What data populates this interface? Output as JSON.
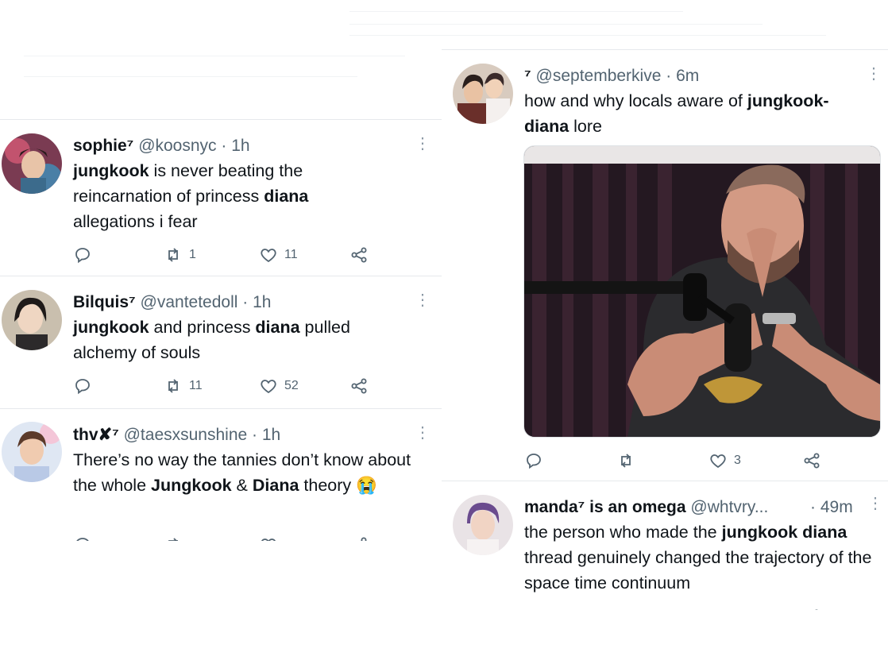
{
  "left_column": {
    "tweets": [
      {
        "name": "sophie⁷",
        "handle": "@koosnyc",
        "time": "1h",
        "text_parts": [
          "jungkook",
          " is never beating the reincarnation of princess ",
          "diana",
          " allegations i fear"
        ],
        "replies": "",
        "retweets": "1",
        "likes": "11"
      },
      {
        "name": "Bilquis⁷",
        "handle": "@vantetedoll",
        "time": "1h",
        "text_parts": [
          "jungkook",
          " and princess ",
          "diana",
          " pulled alchemy of souls"
        ],
        "replies": "",
        "retweets": "11",
        "likes": "52"
      },
      {
        "name": "thv✘⁷",
        "handle": "@taesxsunshine",
        "time": "1h",
        "text_parts": [
          "There’s no way the tannies don’t know about the whole ",
          "Jungkook",
          " & ",
          "Diana",
          " theory ",
          "😭"
        ],
        "replies": "",
        "retweets": "",
        "likes": ""
      }
    ]
  },
  "right_column": {
    "tweets": [
      {
        "name": "⁷",
        "handle": "@septemberkive",
        "time": "6m",
        "text_parts": [
          "how and why locals aware of ",
          "jungkook-diana",
          " lore"
        ],
        "replies": "",
        "retweets": "",
        "likes": "3",
        "has_media": true
      },
      {
        "name": "manda⁷ is an omega",
        "handle": "@whtvry...",
        "time": "49m",
        "text_parts": [
          "the person who made the ",
          "jungkook",
          " ",
          "diana",
          " thread genuinely changed the trajectory of the space time continuum"
        ]
      }
    ]
  },
  "separator": "·",
  "colors": {
    "text": "#0f1419",
    "secondary": "#536471",
    "border": "#e6e9ec"
  },
  "icons": [
    "reply-icon",
    "retweet-icon",
    "like-icon",
    "share-icon",
    "more-icon"
  ]
}
